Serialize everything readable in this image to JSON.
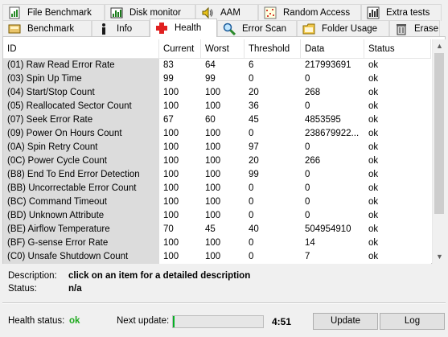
{
  "tabs_top": [
    {
      "label": "File Benchmark",
      "icon": "file-benchmark-icon"
    },
    {
      "label": "Disk monitor",
      "icon": "disk-monitor-icon"
    },
    {
      "label": "AAM",
      "icon": "speaker-icon"
    },
    {
      "label": "Random Access",
      "icon": "random-access-icon"
    },
    {
      "label": "Extra tests",
      "icon": "extra-tests-icon"
    }
  ],
  "tabs_bottom": [
    {
      "label": "Benchmark",
      "icon": "benchmark-icon"
    },
    {
      "label": "Info",
      "icon": "info-icon"
    },
    {
      "label": "Health",
      "icon": "health-cross-icon",
      "active": true
    },
    {
      "label": "Error Scan",
      "icon": "magnifier-icon"
    },
    {
      "label": "Folder Usage",
      "icon": "folder-icon"
    },
    {
      "label": "Erase",
      "icon": "trash-icon"
    }
  ],
  "table": {
    "headers": [
      "ID",
      "Current",
      "Worst",
      "Threshold",
      "Data",
      "Status"
    ],
    "rows": [
      [
        "(01) Raw Read Error Rate",
        "83",
        "64",
        "6",
        "217993691",
        "ok"
      ],
      [
        "(03) Spin Up Time",
        "99",
        "99",
        "0",
        "0",
        "ok"
      ],
      [
        "(04) Start/Stop Count",
        "100",
        "100",
        "20",
        "268",
        "ok"
      ],
      [
        "(05) Reallocated Sector Count",
        "100",
        "100",
        "36",
        "0",
        "ok"
      ],
      [
        "(07) Seek Error Rate",
        "67",
        "60",
        "45",
        "4853595",
        "ok"
      ],
      [
        "(09) Power On Hours Count",
        "100",
        "100",
        "0",
        "238679922...",
        "ok"
      ],
      [
        "(0A) Spin Retry Count",
        "100",
        "100",
        "97",
        "0",
        "ok"
      ],
      [
        "(0C) Power Cycle Count",
        "100",
        "100",
        "20",
        "266",
        "ok"
      ],
      [
        "(B8) End To End Error Detection",
        "100",
        "100",
        "99",
        "0",
        "ok"
      ],
      [
        "(BB) Uncorrectable Error Count",
        "100",
        "100",
        "0",
        "0",
        "ok"
      ],
      [
        "(BC) Command Timeout",
        "100",
        "100",
        "0",
        "0",
        "ok"
      ],
      [
        "(BD) Unknown Attribute",
        "100",
        "100",
        "0",
        "0",
        "ok"
      ],
      [
        "(BE) Airflow Temperature",
        "70",
        "45",
        "40",
        "504954910",
        "ok"
      ],
      [
        "(BF) G-sense Error Rate",
        "100",
        "100",
        "0",
        "14",
        "ok"
      ],
      [
        "(C0) Unsafe Shutdown Count",
        "100",
        "100",
        "0",
        "7",
        "ok"
      ]
    ]
  },
  "description": {
    "label": "Description:",
    "value": "click on an item for a detailed description"
  },
  "status": {
    "label": "Status:",
    "value": "n/a"
  },
  "health": {
    "label": "Health status:",
    "value": "ok",
    "value_color": "#1faa1f"
  },
  "next_update": {
    "label": "Next update:",
    "progress_fraction": 0.02,
    "timer": "4:51"
  },
  "buttons": {
    "update": "Update",
    "log": "Log"
  }
}
